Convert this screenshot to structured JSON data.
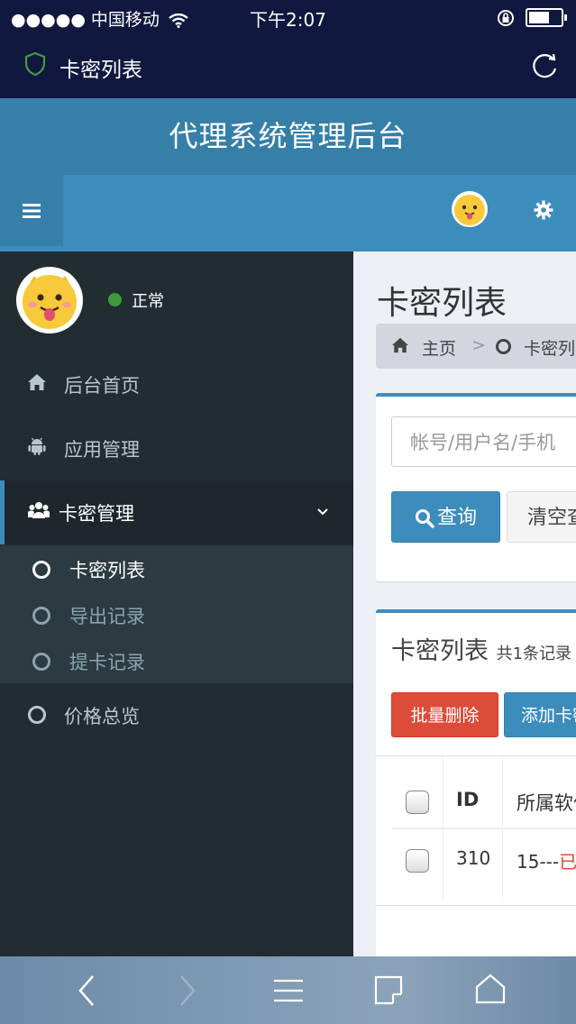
{
  "status_bar": {
    "carrier": "●●●●● 中国移动",
    "time": "下午2:07"
  },
  "nav": {
    "title": "卡密列表"
  },
  "header": {
    "brand": "代理系统管理后台"
  },
  "sidebar": {
    "user_status": "正常",
    "items": [
      {
        "label": "后台首页",
        "icon": "home-icon"
      },
      {
        "label": "应用管理",
        "icon": "android-icon"
      },
      {
        "label": "卡密管理",
        "icon": "users-icon"
      },
      {
        "label": "价格总览",
        "icon": "circle-icon"
      }
    ],
    "submenu": [
      {
        "label": "卡密列表",
        "active": true
      },
      {
        "label": "导出记录",
        "active": false
      },
      {
        "label": "提卡记录",
        "active": false
      }
    ]
  },
  "content": {
    "page_title": "卡密列表",
    "breadcrumb": {
      "home": "主页",
      "separator": ">",
      "current": "卡密列表"
    },
    "search": {
      "placeholder": "帐号/用户名/手机",
      "query_label": "查询",
      "clear_label": "清空查询"
    },
    "list": {
      "title": "卡密列表",
      "count_text": "共1条记录",
      "delete_label": "批量删除",
      "add_label": "添加卡密",
      "columns": [
        "ID",
        "所属软件"
      ],
      "rows": [
        {
          "id": "310",
          "software": "15---",
          "status": "已"
        }
      ]
    }
  },
  "colors": {
    "accent": "#3c8dbc",
    "danger": "#dd4b39",
    "sidebar": "#222d32",
    "status_online": "#3c9a3a"
  }
}
